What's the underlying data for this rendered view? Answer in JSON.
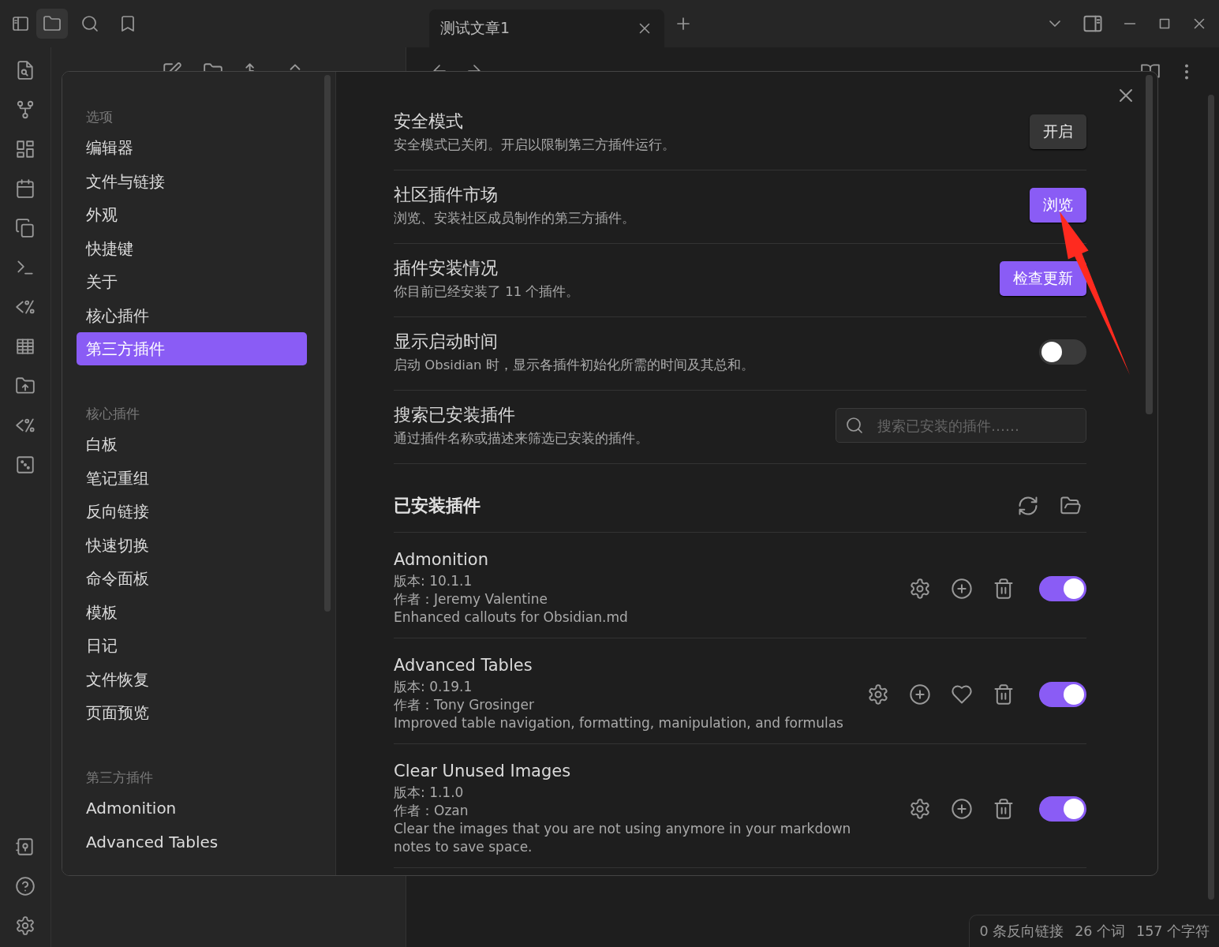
{
  "titlebar": {
    "sidebar_tabs": [
      {
        "kind": "files",
        "selected": true
      },
      {
        "kind": "search",
        "selected": false
      },
      {
        "kind": "bookmarks",
        "selected": false
      }
    ],
    "tabs": [
      {
        "label": "测试文章1",
        "selected": true
      }
    ]
  },
  "settings": {
    "sidebar": [
      {
        "heading": "选项",
        "items": [
          {
            "label": "编辑器",
            "selected": false
          },
          {
            "label": "文件与链接",
            "selected": false
          },
          {
            "label": "外观",
            "selected": false
          },
          {
            "label": "快捷键",
            "selected": false
          },
          {
            "label": "关于",
            "selected": false
          },
          {
            "label": "核心插件",
            "selected": false
          },
          {
            "label": "第三方插件",
            "selected": true
          }
        ]
      },
      {
        "heading": "核心插件",
        "items": [
          {
            "label": "白板",
            "selected": false
          },
          {
            "label": "笔记重组",
            "selected": false
          },
          {
            "label": "反向链接",
            "selected": false
          },
          {
            "label": "快速切换",
            "selected": false
          },
          {
            "label": "命令面板",
            "selected": false
          },
          {
            "label": "模板",
            "selected": false
          },
          {
            "label": "日记",
            "selected": false
          },
          {
            "label": "文件恢复",
            "selected": false
          },
          {
            "label": "页面预览",
            "selected": false
          }
        ]
      },
      {
        "heading": "第三方插件",
        "items": [
          {
            "label": "Admonition",
            "selected": false
          },
          {
            "label": "Advanced Tables",
            "selected": false
          }
        ]
      }
    ],
    "rows": [
      {
        "kind": "button",
        "title": "安全模式",
        "description": "安全模式已关闭。开启以限制第三方插件运行。",
        "button": {
          "label": "开启",
          "primary": false
        }
      },
      {
        "kind": "button",
        "title": "社区插件市场",
        "description": "浏览、安装社区成员制作的第三方插件。",
        "button": {
          "label": "浏览",
          "primary": true
        }
      },
      {
        "kind": "button",
        "title": "插件安装情况",
        "description": "你目前已经安装了 11 个插件。",
        "button": {
          "label": "检查更新",
          "primary": true
        }
      },
      {
        "kind": "toggle",
        "title": "显示启动时间",
        "description": "启动 Obsidian 时，显示各插件初始化所需的时间及其总和。",
        "on": false
      },
      {
        "kind": "search",
        "title": "搜索已安装插件",
        "description": "通过插件名称或描述来筛选已安装的插件。",
        "placeholder": "搜索已安装的插件……"
      }
    ],
    "installed": {
      "heading": "已安装插件",
      "plugins": [
        {
          "name": "Admonition",
          "version": "版本: 10.1.1",
          "author": "作者：Jeremy Valentine",
          "description": "Enhanced callouts for Obsidian.md",
          "actions": [
            {
              "kind": "settings"
            },
            {
              "kind": "hotkeys"
            },
            {
              "kind": "uninstall"
            }
          ],
          "enabled": true
        },
        {
          "name": "Advanced Tables",
          "version": "版本: 0.19.1",
          "author": "作者：Tony Grosinger",
          "description": "Improved table navigation, formatting, manipulation, and formulas",
          "actions": [
            {
              "kind": "settings"
            },
            {
              "kind": "hotkeys"
            },
            {
              "kind": "donate"
            },
            {
              "kind": "uninstall"
            }
          ],
          "enabled": true
        },
        {
          "name": "Clear Unused Images",
          "version": "版本: 1.1.0",
          "author": "作者：Ozan",
          "description": "Clear the images that you are not using anymore in your markdown notes to save space.",
          "actions": [
            {
              "kind": "settings"
            },
            {
              "kind": "hotkeys"
            },
            {
              "kind": "uninstall"
            }
          ],
          "enabled": true
        }
      ]
    }
  },
  "status_bar": {
    "items": [
      "0 条反向链接",
      "26 个词",
      "157 个字符"
    ]
  }
}
